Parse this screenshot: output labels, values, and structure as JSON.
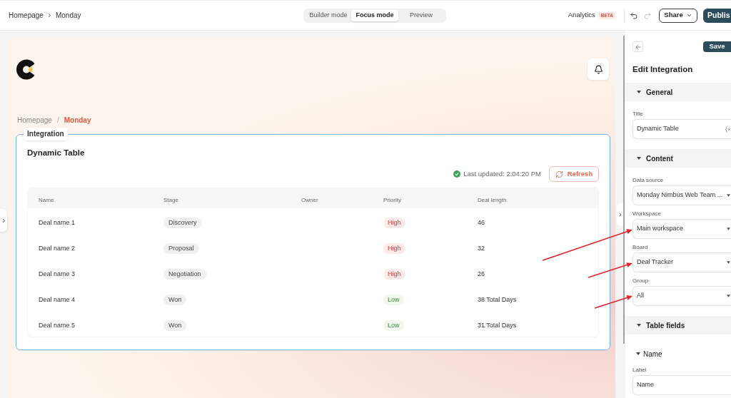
{
  "top_bar": {
    "breadcrumb": [
      "Homepage",
      "Monday"
    ],
    "modes": [
      {
        "label": "Builder mode",
        "selected": false
      },
      {
        "label": "Focus mode",
        "selected": true
      },
      {
        "label": "Preview",
        "selected": false
      }
    ],
    "analytics": {
      "label": "Analytics",
      "badge": "BETA"
    },
    "history": [
      {
        "kind": "undo",
        "disabled": false
      },
      {
        "kind": "redo",
        "disabled": true
      }
    ],
    "share_button": "Share",
    "publish_button": "Publis"
  },
  "canvas": {
    "breadcrumb": [
      {
        "label": "Homepage",
        "selected": false
      },
      {
        "label": "Monday",
        "selected": true
      }
    ],
    "breadcrumb_separator": "/",
    "integration": {
      "tag": "Integration",
      "title": "Dynamic Table",
      "last_updated": "Last updated: 2:04:20 PM",
      "refresh_button": "Refresh",
      "table": {
        "columns": [
          "Name",
          "Stage",
          "Owner",
          "Priority",
          "Deal length"
        ],
        "rows": [
          {
            "name": "Deal name 1",
            "stage": "Discovery",
            "priority": {
              "label": "High",
              "kind": "high"
            },
            "deal_length": "46"
          },
          {
            "name": "Deal name 2",
            "stage": "Proposal",
            "priority": {
              "label": "High",
              "kind": "high"
            },
            "deal_length": "32"
          },
          {
            "name": "Deal name 3",
            "stage": "Negotiation",
            "priority": {
              "label": "High",
              "kind": "high"
            },
            "deal_length": "26"
          },
          {
            "name": "Deal name 4",
            "stage": "Won",
            "priority": {
              "label": "Low",
              "kind": "low"
            },
            "deal_length": "38 Total Days"
          },
          {
            "name": "Deal name 5",
            "stage": "Won",
            "priority": {
              "label": "Low",
              "kind": "low"
            },
            "deal_length": "31 Total Days"
          }
        ]
      }
    }
  },
  "panel": {
    "save_button": "Save",
    "title": "Edit Integration",
    "sections": [
      {
        "title": "General",
        "expanded": true,
        "fields": [
          {
            "kind": "variable",
            "label": "Title",
            "value": "Dynamic Table"
          }
        ]
      },
      {
        "title": "Content",
        "expanded": true,
        "fields": [
          {
            "kind": "select",
            "label": "Data source",
            "value": "Monday Nimbus Web Team ..."
          },
          {
            "kind": "select",
            "label": "Workspace",
            "value": "Main workspace"
          },
          {
            "kind": "select",
            "label": "Board",
            "value": "Deal Tracker"
          },
          {
            "kind": "select",
            "label": "Group",
            "value": "All"
          }
        ]
      },
      {
        "title": "Table fields",
        "expanded": true,
        "groups": [
          {
            "title": "Name",
            "expanded": true,
            "fields": [
              {
                "kind": "text",
                "label": "Label",
                "value": "Name"
              }
            ]
          }
        ]
      }
    ]
  }
}
